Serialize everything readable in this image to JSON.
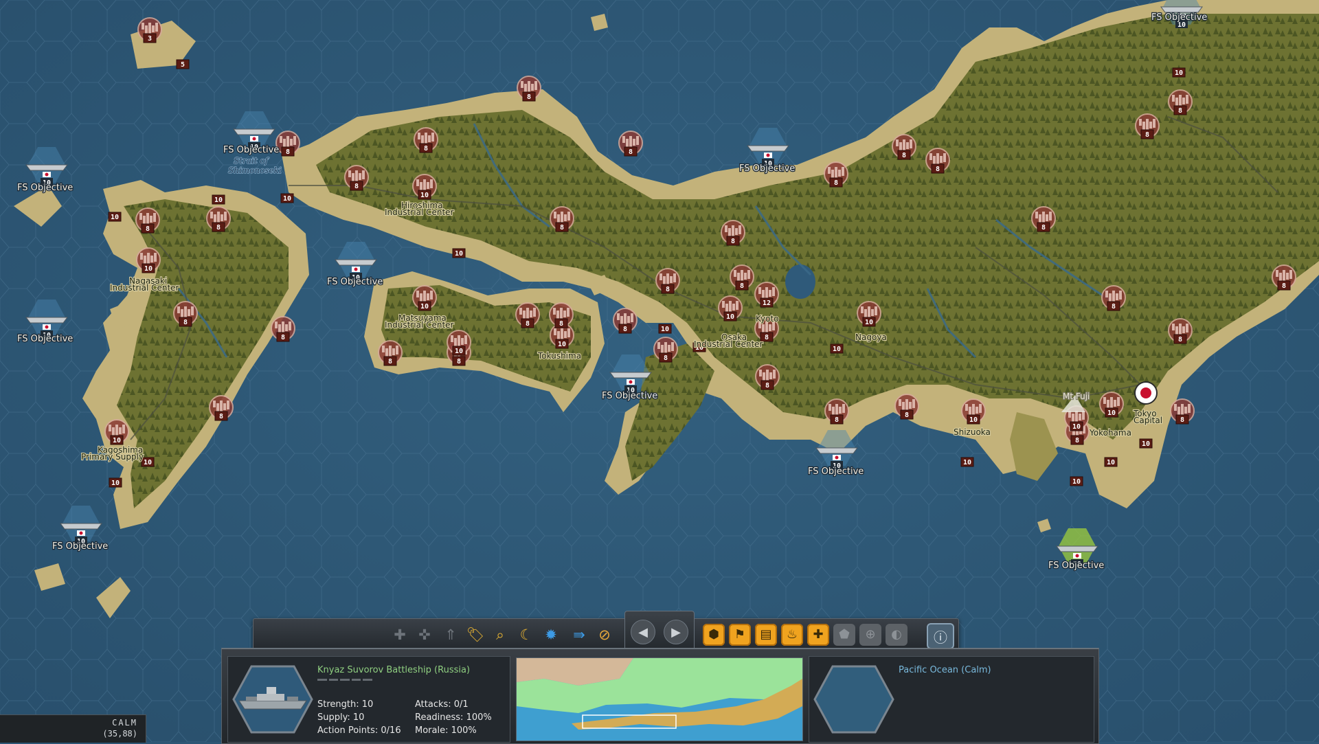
{
  "map": {
    "cities": [
      {
        "name": "Hiroshima",
        "sub": "Industrial Center"
      },
      {
        "name": "Nagasaki",
        "sub": "Industrial Center"
      },
      {
        "name": "Matsuyama",
        "sub": "Industrial Center"
      },
      {
        "name": "Tokushima",
        "sub": ""
      },
      {
        "name": "Kagoshima",
        "sub": "Primary Supply"
      },
      {
        "name": "Kyoto",
        "sub": ""
      },
      {
        "name": "Osaka",
        "sub": "Industrial Center"
      },
      {
        "name": "Nagoya",
        "sub": ""
      },
      {
        "name": "Shizuoka",
        "sub": ""
      },
      {
        "name": "Yokohama",
        "sub": ""
      },
      {
        "name": "Tokyo",
        "sub": "Capital"
      },
      {
        "name": "Mt Fuji",
        "sub": ""
      }
    ],
    "strait_label": "Strait of",
    "strait_label_2": "Shimonoseki",
    "objective_label": "FS Objective",
    "unit_strength_values": [
      "3",
      "5",
      "8",
      "10",
      "12"
    ]
  },
  "toolbar": {
    "icons": [
      "plus-icon",
      "reinforce-icon",
      "upgrade-icon",
      "tag-icon",
      "search-icon",
      "moon-icon",
      "bomb-icon",
      "move-arrows-icon",
      "cancel-icon"
    ],
    "nav": [
      "previous-unit-icon",
      "next-unit-icon"
    ],
    "modes": [
      "hex-mode-icon",
      "supply-icon",
      "production-icon",
      "fire-icon",
      "heal-icon",
      "fortify-icon",
      "repair-icon",
      "night-icon"
    ],
    "info": "info-icon"
  },
  "unit": {
    "name": "Knyaz Suvorov Battleship (Russia)",
    "strength": "Strength: 10",
    "supply": "Supply: 10",
    "action_points": "Action Points: 0/16",
    "attacks": "Attacks: 0/1",
    "readiness": "Readiness: 100%",
    "morale": "Morale: 100%"
  },
  "terrain": {
    "name": "Pacific Ocean (Calm)"
  },
  "status": {
    "weather": "CALM",
    "coords": "(35,88)"
  },
  "colors": {
    "sea": "#2f5a7a",
    "land": "#8c8e4c",
    "forest": "#5d6b2c",
    "enemy_marker": "#9e2b2b",
    "highlight": "#9fce3c"
  }
}
